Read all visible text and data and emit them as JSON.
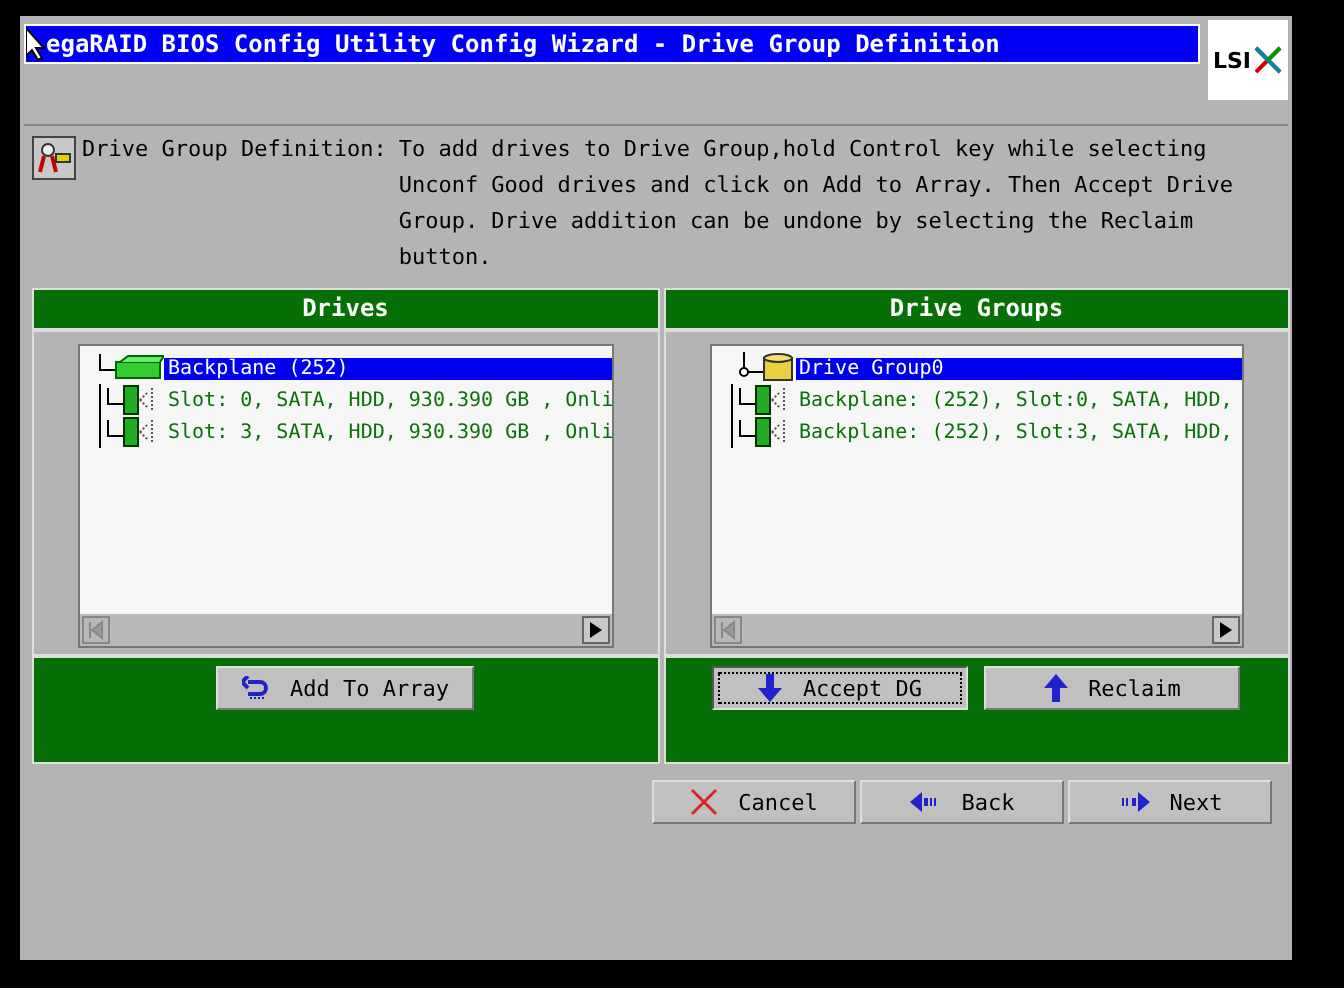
{
  "window": {
    "title": "egaRAID BIOS Config Utility  Config Wizard - Drive Group Definition",
    "logo": "LSI"
  },
  "description": {
    "label": "Drive Group Definition:",
    "text": "To add drives to Drive Group,hold Control key while selecting Unconf Good drives and click on Add to Array. Then Accept Drive Group. Drive addition can be undone by selecting the Reclaim button."
  },
  "panels": [
    {
      "title": "Drives",
      "tree": [
        {
          "kind": "backplane",
          "label": "Backplane (252)",
          "selected": true,
          "children": [
            {
              "kind": "drive",
              "label": "Slot: 0, SATA, HDD, 930.390 GB , Onli",
              "selected": false
            },
            {
              "kind": "drive",
              "label": "Slot: 3, SATA, HDD, 930.390 GB , Onli",
              "selected": false
            }
          ]
        }
      ],
      "buttons": [
        {
          "label": "Add To Array",
          "kind": "undo",
          "focused": false
        }
      ]
    },
    {
      "title": "Drive Groups",
      "tree": [
        {
          "kind": "group",
          "label": "Drive Group0",
          "selected": true,
          "children": [
            {
              "kind": "drive",
              "label": "Backplane: (252), Slot:0, SATA, HDD,",
              "selected": false
            },
            {
              "kind": "drive",
              "label": "Backplane: (252), Slot:3, SATA, HDD,",
              "selected": false
            }
          ]
        }
      ],
      "buttons": [
        {
          "label": "Accept DG",
          "kind": "down",
          "focused": true
        },
        {
          "label": "Reclaim",
          "kind": "up",
          "focused": false
        }
      ]
    }
  ],
  "nav_buttons": [
    {
      "label": "Cancel",
      "kind": "cancel"
    },
    {
      "label": "Back",
      "kind": "back"
    },
    {
      "label": "Next",
      "kind": "next"
    }
  ]
}
